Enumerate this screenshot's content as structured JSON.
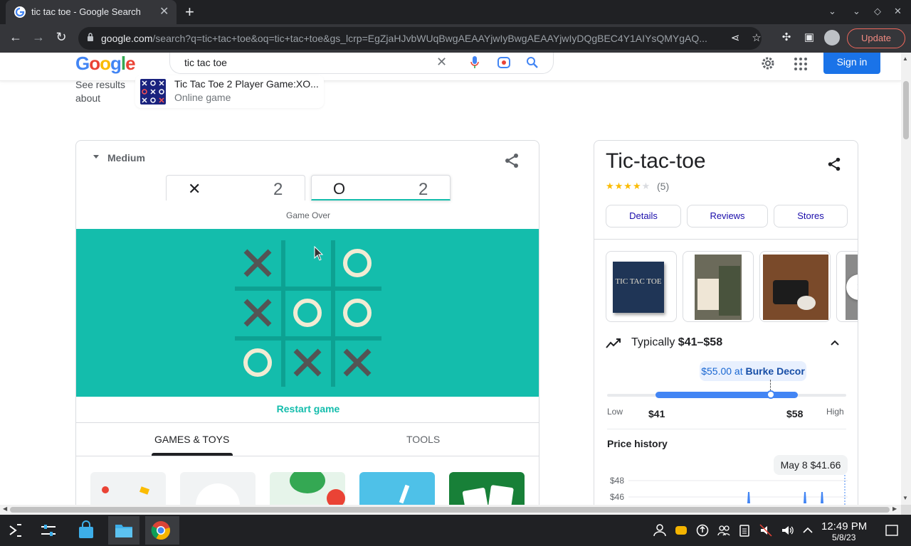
{
  "browser": {
    "tab_title": "tic tac toe - Google Search",
    "url_host": "google.com",
    "url_path": "/search?q=tic+tac+toe&oq=tic+tac+toe&gs_lcrp=EgZjaHJvbWUqBwgAEAAYjwIyBwgAEAAYjwIyDQgBEC4Y1AIYsQMYgAQ...",
    "update_label": "Update"
  },
  "header": {
    "logo_text": "Google",
    "search_value": "tic tac toe",
    "signin_label": "Sign in"
  },
  "see_results": {
    "label": "See results about",
    "title": "Tic Tac Toe 2 Player Game:XO...",
    "subtitle": "Online game"
  },
  "game": {
    "difficulty": "Medium",
    "score_x_mark": "✕",
    "score_x": "2",
    "score_o_mark": "O",
    "score_o": "2",
    "status": "Game Over",
    "board": [
      "X",
      "",
      "O",
      "X",
      "O",
      "O",
      "O",
      "X",
      "X"
    ],
    "restart_label": "Restart game",
    "tabs": [
      "GAMES & TOYS",
      "TOOLS"
    ],
    "colors": {
      "board_bg": "#14bdac",
      "x_color": "#545454",
      "o_color": "#f2ebd3"
    }
  },
  "knowledge_panel": {
    "title": "Tic-tac-toe",
    "stars": "★★★★",
    "star_empty": "★",
    "reviews": "(5)",
    "buttons": [
      "Details",
      "Reviews",
      "Stores"
    ],
    "typically_prefix": "Typically ",
    "typically_range": "$41–$58",
    "price_tip_price": "$55.00",
    "price_tip_at": " at ",
    "price_tip_store": "Burke Decor",
    "low_label": "Low",
    "low_value": "$41",
    "high_value": "$58",
    "high_label": "High",
    "price_history_title": "Price history",
    "price_history_tip": "May 8 $41.66",
    "y_ticks": [
      "$48",
      "$46"
    ],
    "thumb_text": "TIC TAC TOE"
  },
  "taskbar": {
    "time": "12:49 PM",
    "date": "5/8/23"
  }
}
